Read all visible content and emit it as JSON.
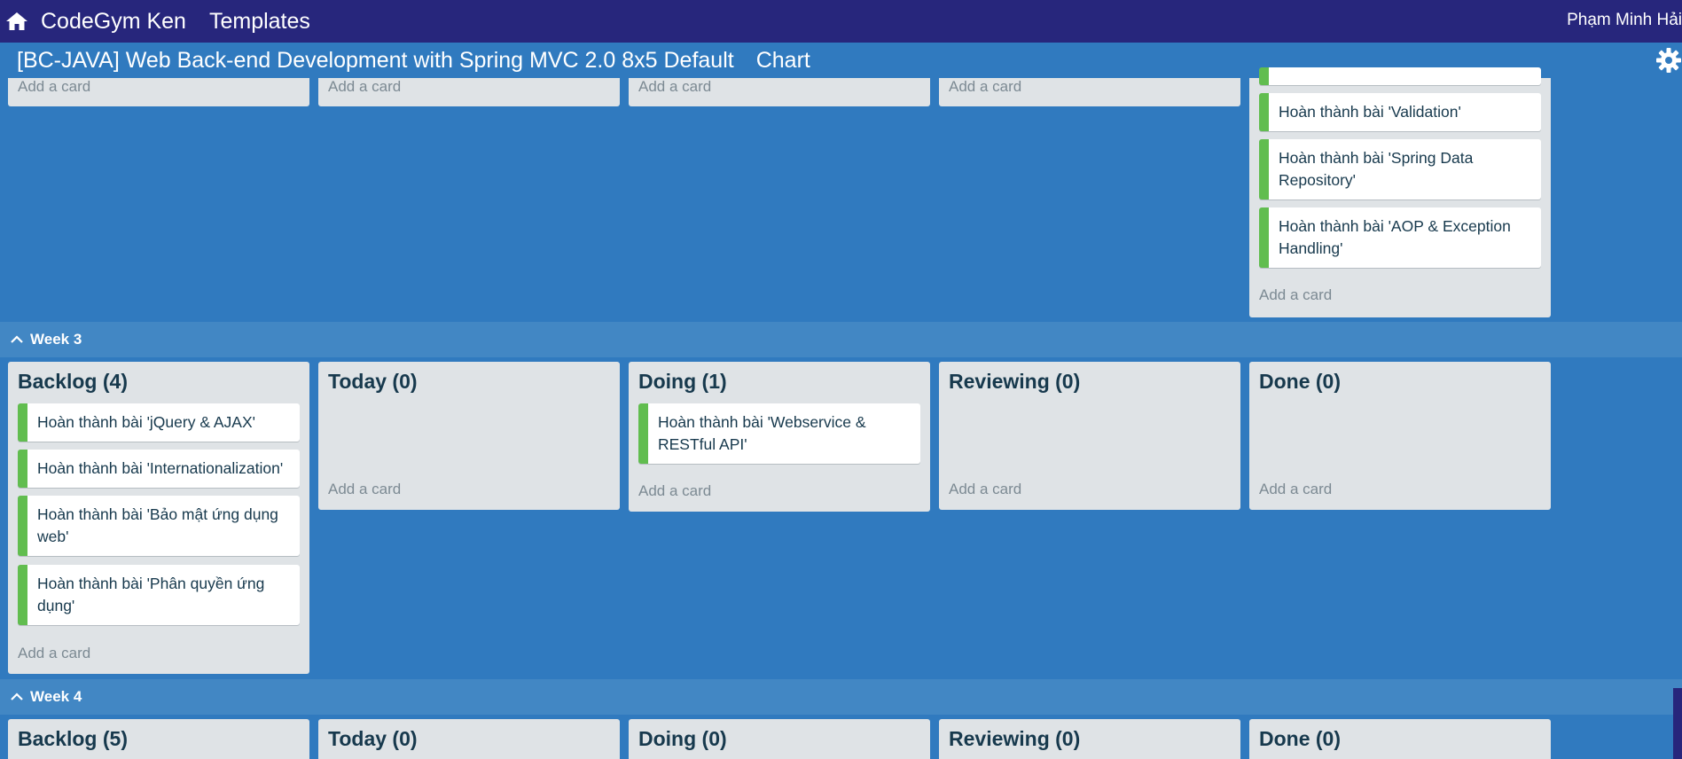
{
  "app": {
    "brand": "CodeGym Ken",
    "templates_label": "Templates",
    "user_name": "Phạm Minh Hải"
  },
  "board": {
    "title": "[BC-JAVA] Web Back-end Development with Spring MVC 2.0 8x5 Default",
    "chart_label": "Chart"
  },
  "labels": {
    "add_card": "Add a card"
  },
  "week2_done": {
    "cards": [
      "Hoàn thành bài 'Validation'",
      "Hoàn thành bài 'Spring Data Repository'",
      "Hoàn thành bài 'AOP & Exception Handling'"
    ]
  },
  "week3": {
    "label": "Week 3",
    "lists": [
      {
        "title": "Backlog (4)",
        "cards": [
          "Hoàn thành bài 'jQuery & AJAX'",
          "Hoàn thành bài 'Internationalization'",
          "Hoàn thành bài 'Bảo mật ứng dụng web'",
          "Hoàn thành bài 'Phân quyền ứng dụng'"
        ]
      },
      {
        "title": "Today (0)",
        "cards": []
      },
      {
        "title": "Doing (1)",
        "cards": [
          "Hoàn thành bài 'Webservice & RESTful API'"
        ]
      },
      {
        "title": "Reviewing (0)",
        "cards": []
      },
      {
        "title": "Done (0)",
        "cards": []
      }
    ]
  },
  "week4": {
    "label": "Week 4",
    "lists": [
      {
        "title": "Backlog (5)"
      },
      {
        "title": "Today (0)"
      },
      {
        "title": "Doing (0)"
      },
      {
        "title": "Reviewing (0)"
      },
      {
        "title": "Done (0)"
      }
    ]
  },
  "colors": {
    "topbar": "#27267c",
    "board_bg": "#307abf",
    "lane_bg": "#4287c4",
    "list_bg": "#dfe3e6",
    "card_label_green": "#61bd4f"
  }
}
